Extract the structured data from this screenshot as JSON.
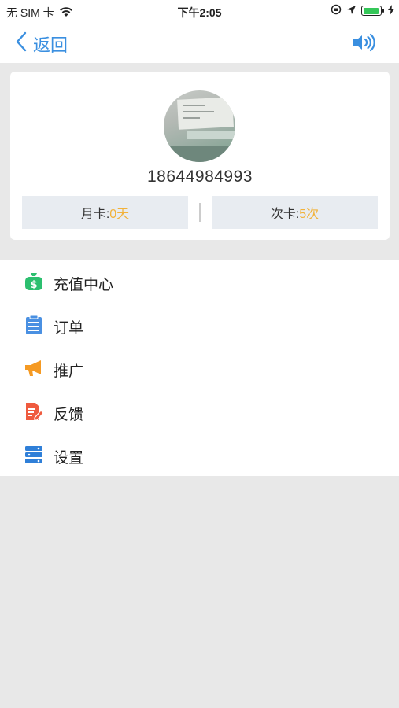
{
  "status_bar": {
    "carrier": "无 SIM 卡",
    "time": "下午2:05"
  },
  "nav": {
    "back_label": "返回"
  },
  "profile": {
    "phone": "18644984993",
    "month_card_label": "月卡:",
    "month_card_value": "0天",
    "times_card_label": "次卡:",
    "times_card_value": "5次"
  },
  "menu": {
    "items": [
      {
        "label": "充值中心",
        "icon": "money-bag-icon",
        "color": "#2cbf6f"
      },
      {
        "label": "订单",
        "icon": "clipboard-list-icon",
        "color": "#4a90e2"
      },
      {
        "label": "推广",
        "icon": "megaphone-icon",
        "color": "#f59a23"
      },
      {
        "label": "反馈",
        "icon": "feedback-edit-icon",
        "color": "#ef5b3f"
      },
      {
        "label": "设置",
        "icon": "settings-bars-icon",
        "color": "#2f7fd8"
      }
    ]
  },
  "colors": {
    "accent": "#3a8fe0",
    "value_highlight": "#f2b23a",
    "background": "#e8e8e8"
  }
}
